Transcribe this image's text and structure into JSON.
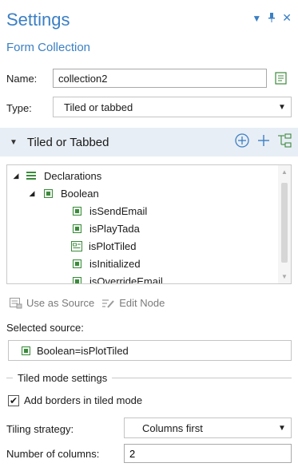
{
  "header": {
    "title": "Settings",
    "subtitle": "Form Collection",
    "controls": [
      "dropdown-caret-icon",
      "pin-icon",
      "close-icon"
    ]
  },
  "name_row": {
    "label": "Name:",
    "value": "collection2"
  },
  "type_row": {
    "label": "Type:",
    "value": "Tiled or tabbed"
  },
  "section": {
    "title": "Tiled or Tabbed"
  },
  "tree": {
    "items": [
      {
        "label": "Declarations",
        "level": 0,
        "expanded": true,
        "icon": "declarations-icon"
      },
      {
        "label": "Boolean",
        "level": 1,
        "expanded": true,
        "icon": "boolean-icon"
      },
      {
        "label": "isSendEmail",
        "level": 2,
        "icon": "boolean-var-icon"
      },
      {
        "label": "isPlayTada",
        "level": 2,
        "icon": "boolean-var-icon"
      },
      {
        "label": "isPlotTiled",
        "level": 2,
        "icon": "form-var-icon"
      },
      {
        "label": "isInitialized",
        "level": 2,
        "icon": "boolean-var-icon"
      },
      {
        "label": "isOverrideEmail",
        "level": 2,
        "icon": "boolean-var-icon"
      }
    ]
  },
  "toolbar": {
    "use_as_source": "Use as Source",
    "edit_node": "Edit Node"
  },
  "selected_source": {
    "label": "Selected source:",
    "value": "Boolean=isPlotTiled"
  },
  "tiled_group": {
    "title": "Tiled mode settings",
    "borders_label": "Add borders in tiled mode",
    "borders_checked": true,
    "tiling_label": "Tiling strategy:",
    "tiling_value": "Columns first",
    "columns_label": "Number of columns:",
    "columns_value": "2"
  },
  "colors": {
    "accent": "#3b7fc4",
    "section_bg": "#e8eef5",
    "icon_green": "#3c8a3c"
  }
}
